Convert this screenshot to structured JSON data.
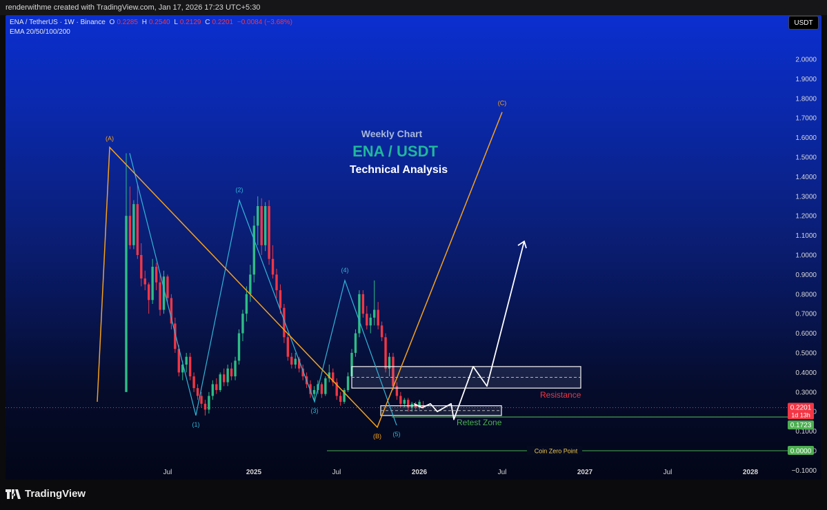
{
  "topbar": {
    "text": "renderwithme created with TradingView.com, Jan 17, 2026 17:23 UTC+5:30"
  },
  "legend": {
    "symbol": "ENA / TetherUS · 1W · Binance",
    "o_label": "O",
    "o_value": "0.2285",
    "h_label": "H",
    "h_value": "0.2540",
    "l_label": "L",
    "l_value": "0.2129",
    "c_label": "C",
    "c_value": "0.2201",
    "change": "−0.0084 (−3.68%)",
    "indicator": "EMA 20/50/100/200"
  },
  "currency_badge": "USDT",
  "branding": "TradingView",
  "colors": {
    "up": "#2ebd85",
    "down": "#f23645",
    "wave_abc": "#f7a21b",
    "wave_impulse": "#33b5d8",
    "projection": "#ffffff",
    "support": "#4caf50",
    "resistance_text": "#f23645",
    "retest_text": "#4caf50"
  },
  "chart_data": {
    "type": "candlestick",
    "symbol": "ENA / USDT",
    "timeframe": "1W",
    "y_axis": {
      "ticks": [
        "2.0000",
        "1.9000",
        "1.8000",
        "1.7000",
        "1.6000",
        "1.5000",
        "1.4000",
        "1.3000",
        "1.2000",
        "1.1000",
        "1.0000",
        "0.9000",
        "0.8000",
        "0.7000",
        "0.6000",
        "0.5000",
        "0.4000",
        "0.3000",
        "0.2000",
        "0.1000",
        "0.0000",
        "−0.1000"
      ],
      "range": [
        -0.1,
        2.0
      ]
    },
    "x_axis": {
      "ticks": [
        "Jul",
        "2025",
        "Jul",
        "2026",
        "Jul",
        "2027",
        "Jul",
        "2028"
      ]
    },
    "candles": [
      {
        "o": 0.3,
        "h": 1.52,
        "l": 0.3,
        "c": 1.2
      },
      {
        "o": 1.2,
        "h": 1.35,
        "l": 1.03,
        "c": 1.05
      },
      {
        "o": 1.05,
        "h": 1.28,
        "l": 1.03,
        "c": 1.26
      },
      {
        "o": 1.26,
        "h": 1.36,
        "l": 0.98,
        "c": 1.0
      },
      {
        "o": 1.0,
        "h": 1.06,
        "l": 0.84,
        "c": 0.88
      },
      {
        "o": 0.88,
        "h": 0.92,
        "l": 0.82,
        "c": 0.85
      },
      {
        "o": 0.85,
        "h": 0.86,
        "l": 0.7,
        "c": 0.77
      },
      {
        "o": 0.77,
        "h": 0.98,
        "l": 0.75,
        "c": 0.94
      },
      {
        "o": 0.94,
        "h": 0.96,
        "l": 0.82,
        "c": 0.86
      },
      {
        "o": 0.86,
        "h": 0.9,
        "l": 0.69,
        "c": 0.72
      },
      {
        "o": 0.72,
        "h": 0.92,
        "l": 0.7,
        "c": 0.89
      },
      {
        "o": 0.89,
        "h": 0.9,
        "l": 0.76,
        "c": 0.78
      },
      {
        "o": 0.78,
        "h": 0.8,
        "l": 0.62,
        "c": 0.65
      },
      {
        "o": 0.65,
        "h": 0.68,
        "l": 0.5,
        "c": 0.52
      },
      {
        "o": 0.52,
        "h": 0.54,
        "l": 0.38,
        "c": 0.4
      },
      {
        "o": 0.4,
        "h": 0.46,
        "l": 0.36,
        "c": 0.44
      },
      {
        "o": 0.44,
        "h": 0.5,
        "l": 0.4,
        "c": 0.48
      },
      {
        "o": 0.48,
        "h": 0.5,
        "l": 0.36,
        "c": 0.38
      },
      {
        "o": 0.38,
        "h": 0.4,
        "l": 0.3,
        "c": 0.32
      },
      {
        "o": 0.32,
        "h": 0.34,
        "l": 0.26,
        "c": 0.28
      },
      {
        "o": 0.28,
        "h": 0.3,
        "l": 0.22,
        "c": 0.24
      },
      {
        "o": 0.24,
        "h": 0.26,
        "l": 0.18,
        "c": 0.21
      },
      {
        "o": 0.21,
        "h": 0.3,
        "l": 0.19,
        "c": 0.28
      },
      {
        "o": 0.28,
        "h": 0.36,
        "l": 0.26,
        "c": 0.34
      },
      {
        "o": 0.34,
        "h": 0.37,
        "l": 0.29,
        "c": 0.31
      },
      {
        "o": 0.31,
        "h": 0.4,
        "l": 0.3,
        "c": 0.39
      },
      {
        "o": 0.39,
        "h": 0.42,
        "l": 0.33,
        "c": 0.35
      },
      {
        "o": 0.35,
        "h": 0.44,
        "l": 0.33,
        "c": 0.42
      },
      {
        "o": 0.42,
        "h": 0.45,
        "l": 0.36,
        "c": 0.38
      },
      {
        "o": 0.38,
        "h": 0.48,
        "l": 0.36,
        "c": 0.46
      },
      {
        "o": 0.46,
        "h": 0.62,
        "l": 0.44,
        "c": 0.6
      },
      {
        "o": 0.6,
        "h": 0.72,
        "l": 0.56,
        "c": 0.7
      },
      {
        "o": 0.7,
        "h": 0.84,
        "l": 0.66,
        "c": 0.8
      },
      {
        "o": 0.8,
        "h": 0.95,
        "l": 0.76,
        "c": 0.9
      },
      {
        "o": 0.9,
        "h": 1.2,
        "l": 0.86,
        "c": 1.15
      },
      {
        "o": 1.15,
        "h": 1.3,
        "l": 1.05,
        "c": 1.25
      },
      {
        "o": 1.25,
        "h": 1.29,
        "l": 1.0,
        "c": 1.05
      },
      {
        "o": 1.05,
        "h": 1.27,
        "l": 1.02,
        "c": 1.25
      },
      {
        "o": 1.25,
        "h": 1.28,
        "l": 0.95,
        "c": 0.98
      },
      {
        "o": 0.98,
        "h": 1.05,
        "l": 0.88,
        "c": 0.9
      },
      {
        "o": 0.9,
        "h": 0.93,
        "l": 0.78,
        "c": 0.82
      },
      {
        "o": 0.82,
        "h": 0.85,
        "l": 0.7,
        "c": 0.73
      },
      {
        "o": 0.73,
        "h": 0.75,
        "l": 0.55,
        "c": 0.58
      },
      {
        "o": 0.58,
        "h": 0.6,
        "l": 0.46,
        "c": 0.48
      },
      {
        "o": 0.48,
        "h": 0.5,
        "l": 0.42,
        "c": 0.44
      },
      {
        "o": 0.44,
        "h": 0.5,
        "l": 0.42,
        "c": 0.47
      },
      {
        "o": 0.47,
        "h": 0.48,
        "l": 0.4,
        "c": 0.42
      },
      {
        "o": 0.42,
        "h": 0.44,
        "l": 0.36,
        "c": 0.38
      },
      {
        "o": 0.38,
        "h": 0.4,
        "l": 0.32,
        "c": 0.34
      },
      {
        "o": 0.34,
        "h": 0.36,
        "l": 0.27,
        "c": 0.29
      },
      {
        "o": 0.29,
        "h": 0.33,
        "l": 0.26,
        "c": 0.31
      },
      {
        "o": 0.31,
        "h": 0.36,
        "l": 0.29,
        "c": 0.34
      },
      {
        "o": 0.34,
        "h": 0.35,
        "l": 0.27,
        "c": 0.29
      },
      {
        "o": 0.29,
        "h": 0.38,
        "l": 0.28,
        "c": 0.37
      },
      {
        "o": 0.37,
        "h": 0.44,
        "l": 0.35,
        "c": 0.4
      },
      {
        "o": 0.4,
        "h": 0.42,
        "l": 0.33,
        "c": 0.35
      },
      {
        "o": 0.35,
        "h": 0.37,
        "l": 0.26,
        "c": 0.28
      },
      {
        "o": 0.28,
        "h": 0.3,
        "l": 0.23,
        "c": 0.25
      },
      {
        "o": 0.25,
        "h": 0.32,
        "l": 0.24,
        "c": 0.31
      },
      {
        "o": 0.31,
        "h": 0.4,
        "l": 0.3,
        "c": 0.38
      },
      {
        "o": 0.38,
        "h": 0.52,
        "l": 0.36,
        "c": 0.5
      },
      {
        "o": 0.5,
        "h": 0.62,
        "l": 0.48,
        "c": 0.6
      },
      {
        "o": 0.6,
        "h": 0.82,
        "l": 0.58,
        "c": 0.8
      },
      {
        "o": 0.8,
        "h": 0.82,
        "l": 0.68,
        "c": 0.7
      },
      {
        "o": 0.7,
        "h": 0.74,
        "l": 0.62,
        "c": 0.64
      },
      {
        "o": 0.64,
        "h": 0.7,
        "l": 0.6,
        "c": 0.68
      },
      {
        "o": 0.68,
        "h": 0.87,
        "l": 0.64,
        "c": 0.72
      },
      {
        "o": 0.72,
        "h": 0.76,
        "l": 0.62,
        "c": 0.64
      },
      {
        "o": 0.64,
        "h": 0.66,
        "l": 0.56,
        "c": 0.58
      },
      {
        "o": 0.58,
        "h": 0.6,
        "l": 0.4,
        "c": 0.42
      },
      {
        "o": 0.42,
        "h": 0.5,
        "l": 0.38,
        "c": 0.48
      },
      {
        "o": 0.48,
        "h": 0.5,
        "l": 0.31,
        "c": 0.33
      },
      {
        "o": 0.33,
        "h": 0.35,
        "l": 0.26,
        "c": 0.28
      },
      {
        "o": 0.28,
        "h": 0.3,
        "l": 0.22,
        "c": 0.24
      },
      {
        "o": 0.24,
        "h": 0.27,
        "l": 0.22,
        "c": 0.26
      },
      {
        "o": 0.26,
        "h": 0.27,
        "l": 0.2,
        "c": 0.22
      },
      {
        "o": 0.22,
        "h": 0.25,
        "l": 0.2,
        "c": 0.24
      },
      {
        "o": 0.24,
        "h": 0.25,
        "l": 0.21,
        "c": 0.22
      },
      {
        "o": 0.22,
        "h": 0.26,
        "l": 0.21,
        "c": 0.25
      },
      {
        "o": 0.2285,
        "h": 0.254,
        "l": 0.2129,
        "c": 0.2201
      }
    ],
    "elliott_abc": [
      {
        "label": "",
        "price": 0.25
      },
      {
        "label": "(A)",
        "price": 1.55
      },
      {
        "label": "(B)",
        "price": 0.12
      },
      {
        "label": "(C)",
        "price": 1.73
      }
    ],
    "impulse_waves": [
      {
        "label": "",
        "price": 1.52
      },
      {
        "label": "(1)",
        "price": 0.18
      },
      {
        "label": "(2)",
        "price": 1.28
      },
      {
        "label": "(3)",
        "price": 0.25
      },
      {
        "label": "(4)",
        "price": 0.87
      },
      {
        "label": "(5)",
        "price": 0.13
      }
    ],
    "projection_path": [
      0.24,
      0.22,
      0.24,
      0.2,
      0.24,
      0.16,
      0.43,
      0.33,
      1.07
    ],
    "zones": [
      {
        "label": "Resistance",
        "top": 0.43,
        "bottom": 0.32
      },
      {
        "label": "Retest Zone",
        "top": 0.23,
        "bottom": 0.18
      }
    ],
    "support_line": {
      "price": 0.1723,
      "label": "0.1723"
    },
    "zero_line": {
      "price": 0.0,
      "label": "Coin Zero Point",
      "value_label": "0.0000"
    },
    "last_price": {
      "value": "0.2201",
      "countdown": "1d 13h"
    },
    "annotations": {
      "line1": "Weekly Chart",
      "line2": "ENA / USDT",
      "line3": "Technical Analysis"
    }
  }
}
